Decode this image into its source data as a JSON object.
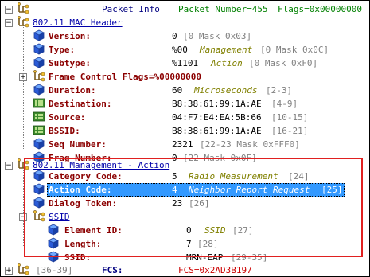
{
  "header": {
    "title": "Packet Info",
    "packet_number": "Packet Number=455",
    "flags": "Flags=0x00000000"
  },
  "rows": [
    {
      "name": "802.11 MAC Header"
    },
    {
      "label": "Version:",
      "value": "0",
      "mask": "[0 Mask 0x03]"
    },
    {
      "label": "Type:",
      "value": "%00",
      "desc": "Management",
      "mask": "[0 Mask 0x0C]"
    },
    {
      "label": "Subtype:",
      "value": "%1101",
      "desc": "Action",
      "mask": "[0 Mask 0xF0]"
    },
    {
      "label": "Frame Control Flags=%00000000"
    },
    {
      "label": "Duration:",
      "value": "60",
      "desc": "Microseconds",
      "mask": "[2-3]"
    },
    {
      "label": "Destination:",
      "value": "B8:38:61:99:1A:AE",
      "mask": "[4-9]"
    },
    {
      "label": "Source:",
      "value": "04:F7:E4:EA:5B:66",
      "mask": "[10-15]"
    },
    {
      "label": "BSSID:",
      "value": "B8:38:61:99:1A:AE",
      "mask": "[16-21]"
    },
    {
      "label": "Seq Number:",
      "value": "2321",
      "mask": "[22-23 Mask 0xFFF0]"
    },
    {
      "label": "Frag Number:",
      "value": "0",
      "mask": "[22 Mask 0x0F]"
    },
    {
      "name": "802.11 Management - Action"
    },
    {
      "label": "Category Code:",
      "value": "5",
      "desc": "Radio Measurement",
      "mask": "[24]"
    },
    {
      "label": "Action Code:",
      "value": "4",
      "desc": "Neighbor Report Request",
      "mask": "[25]"
    },
    {
      "label": "Dialog Token:",
      "value": "23",
      "mask": "[26]"
    },
    {
      "name": "SSID"
    },
    {
      "label": "Element ID:",
      "value": "0",
      "desc": "SSID",
      "mask": "[27]"
    },
    {
      "label": "Length:",
      "value": "7",
      "mask": "[28]"
    },
    {
      "label": "SSID:",
      "value": "MRN-EAP",
      "mask": "[29-35]"
    }
  ],
  "footer": {
    "range": "[36-39]",
    "label": "FCS:",
    "value": "FCS=0x2AD3B197"
  },
  "toggles": {
    "minus": "−",
    "plus": "+"
  },
  "colors": {
    "label": "#8b0000",
    "value_blue": "#0000cc",
    "desc": "#808000",
    "mask": "#808080",
    "selection": "#3399ff",
    "highlight_box": "#e02020"
  },
  "icons": {
    "header": "tree-root-icon",
    "section": "tree-branch-icon",
    "field": "blue-cube-icon",
    "address": "green-network-icon"
  }
}
